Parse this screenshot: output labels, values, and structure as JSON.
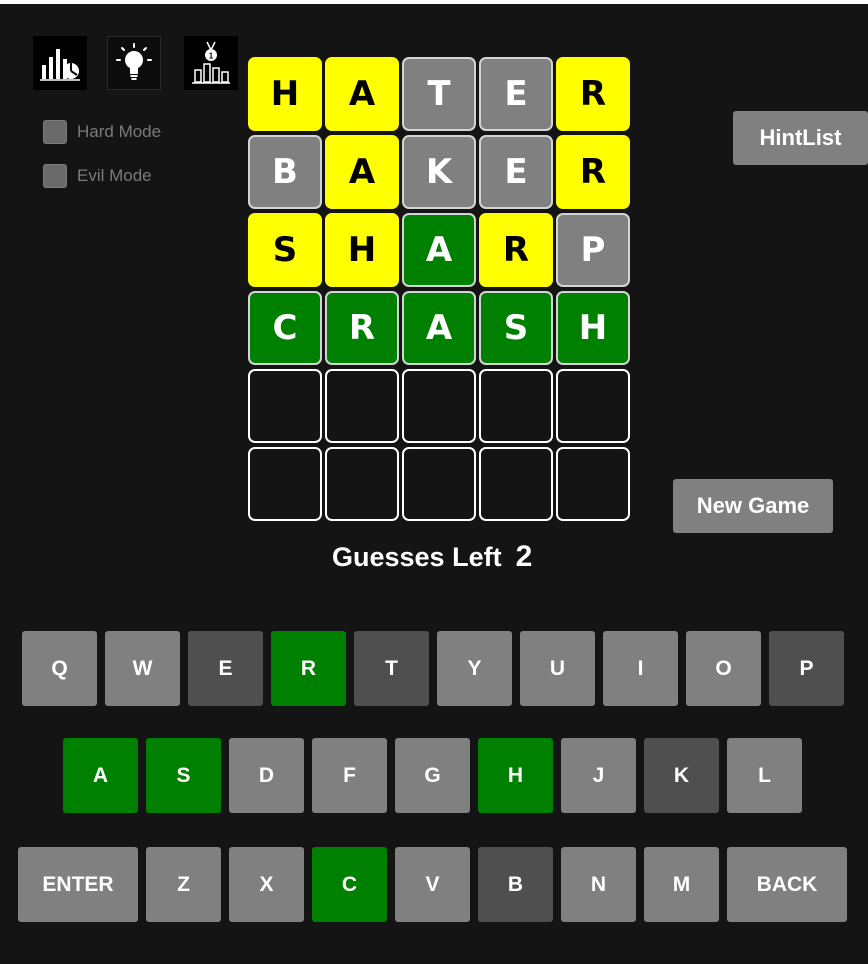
{
  "options": {
    "hard_mode_label": "Hard Mode",
    "evil_mode_label": "Evil Mode"
  },
  "colors": {
    "background": "#141414",
    "yellow": "#ffff00",
    "green": "#008000",
    "gray": "#808080",
    "dark_gray": "#4f4f4f"
  },
  "icons": [
    "stats-chart-icon",
    "lightbulb-icon",
    "leaderboard-medal-icon"
  ],
  "board": {
    "rows": [
      [
        {
          "letter": "H",
          "state": "yellow"
        },
        {
          "letter": "A",
          "state": "yellow"
        },
        {
          "letter": "T",
          "state": "gray"
        },
        {
          "letter": "E",
          "state": "gray"
        },
        {
          "letter": "R",
          "state": "yellow"
        }
      ],
      [
        {
          "letter": "B",
          "state": "gray"
        },
        {
          "letter": "A",
          "state": "yellow"
        },
        {
          "letter": "K",
          "state": "gray"
        },
        {
          "letter": "E",
          "state": "gray"
        },
        {
          "letter": "R",
          "state": "yellow"
        }
      ],
      [
        {
          "letter": "S",
          "state": "yellow"
        },
        {
          "letter": "H",
          "state": "yellow"
        },
        {
          "letter": "A",
          "state": "green"
        },
        {
          "letter": "R",
          "state": "yellow"
        },
        {
          "letter": "P",
          "state": "gray"
        }
      ],
      [
        {
          "letter": "C",
          "state": "green"
        },
        {
          "letter": "R",
          "state": "green"
        },
        {
          "letter": "A",
          "state": "green"
        },
        {
          "letter": "S",
          "state": "green"
        },
        {
          "letter": "H",
          "state": "green"
        }
      ],
      [
        {
          "letter": "",
          "state": "empty"
        },
        {
          "letter": "",
          "state": "empty"
        },
        {
          "letter": "",
          "state": "empty"
        },
        {
          "letter": "",
          "state": "empty"
        },
        {
          "letter": "",
          "state": "empty"
        }
      ],
      [
        {
          "letter": "",
          "state": "empty"
        },
        {
          "letter": "",
          "state": "empty"
        },
        {
          "letter": "",
          "state": "empty"
        },
        {
          "letter": "",
          "state": "empty"
        },
        {
          "letter": "",
          "state": "empty"
        }
      ]
    ]
  },
  "buttons": {
    "hintlist": "HintList",
    "new_game": "New Game"
  },
  "status": {
    "guesses_left_label": "Guesses Left",
    "guesses_left_value": "2"
  },
  "keyboard": {
    "rows": [
      [
        {
          "key": "Q",
          "state": "gray"
        },
        {
          "key": "W",
          "state": "gray"
        },
        {
          "key": "E",
          "state": "dark"
        },
        {
          "key": "R",
          "state": "green"
        },
        {
          "key": "T",
          "state": "dark"
        },
        {
          "key": "Y",
          "state": "gray"
        },
        {
          "key": "U",
          "state": "gray"
        },
        {
          "key": "I",
          "state": "gray"
        },
        {
          "key": "O",
          "state": "gray"
        },
        {
          "key": "P",
          "state": "dark"
        }
      ],
      [
        {
          "key": "A",
          "state": "green"
        },
        {
          "key": "S",
          "state": "green"
        },
        {
          "key": "D",
          "state": "gray"
        },
        {
          "key": "F",
          "state": "gray"
        },
        {
          "key": "G",
          "state": "gray"
        },
        {
          "key": "H",
          "state": "green"
        },
        {
          "key": "J",
          "state": "gray"
        },
        {
          "key": "K",
          "state": "dark"
        },
        {
          "key": "L",
          "state": "gray"
        }
      ],
      [
        {
          "key": "ENTER",
          "state": "gray"
        },
        {
          "key": "Z",
          "state": "gray"
        },
        {
          "key": "X",
          "state": "gray"
        },
        {
          "key": "C",
          "state": "green"
        },
        {
          "key": "V",
          "state": "gray"
        },
        {
          "key": "B",
          "state": "dark"
        },
        {
          "key": "N",
          "state": "gray"
        },
        {
          "key": "M",
          "state": "gray"
        },
        {
          "key": "BACK",
          "state": "gray"
        }
      ]
    ]
  }
}
